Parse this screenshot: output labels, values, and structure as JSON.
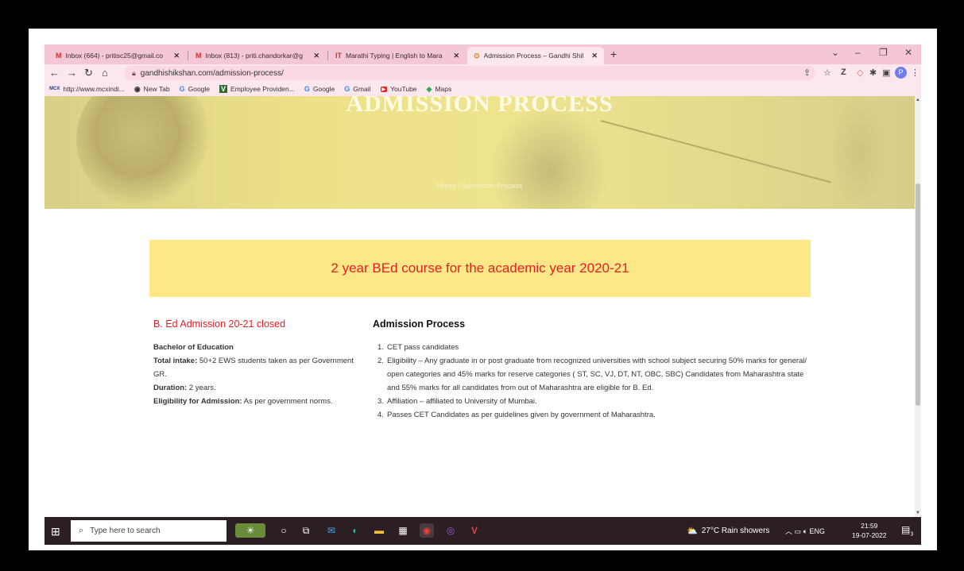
{
  "browser": {
    "tabs": [
      {
        "icon": "gmail-icon",
        "glyph": "M",
        "title": "Inbox (664) - pritisc25@gmail.co",
        "color": "#d93025"
      },
      {
        "icon": "gmail-icon",
        "glyph": "M",
        "title": "Inbox (813) - priti.chandorkar@g",
        "color": "#d93025"
      },
      {
        "icon": "typing-icon",
        "glyph": "IT",
        "title": "Marathi Typing | English to Mara",
        "color": "#d93025"
      },
      {
        "icon": "site-icon",
        "glyph": "⊙",
        "title": "Admission Process – Gandhi Shil",
        "color": "#e8710a"
      }
    ],
    "close_glyph": "✕",
    "new_tab_glyph": "+",
    "url": "gandhishikshan.com/admission-process/",
    "profile_initial": "P",
    "bookmarks": [
      {
        "icon": "mcx-icon",
        "glyph": "MCX",
        "label": "http://www.mcxindi..."
      },
      {
        "icon": "globe-icon",
        "glyph": "◉",
        "label": "New Tab"
      },
      {
        "icon": "google-icon",
        "glyph": "G",
        "label": "Google"
      },
      {
        "icon": "epfo-icon",
        "glyph": "V",
        "label": "Employee Providen..."
      },
      {
        "icon": "google-icon",
        "glyph": "G",
        "label": "Google"
      },
      {
        "icon": "google-icon",
        "glyph": "G",
        "label": "Gmail"
      },
      {
        "icon": "youtube-icon",
        "glyph": "▶",
        "label": "YouTube"
      },
      {
        "icon": "maps-icon",
        "glyph": "◆",
        "label": "Maps"
      }
    ]
  },
  "hero": {
    "title": "ADMISSION PROCESS",
    "breadcrumb": "Home  /  Admission Process"
  },
  "banner": {
    "text": "2 year BEd course for the academic year 2020-21"
  },
  "left": {
    "heading": "B. Ed Admission 20-21 closed",
    "course": "Bachelor of Education",
    "intake_label": "Total intake:",
    "intake_value": " 50+2 EWS students taken as per Government GR.",
    "duration_label": "Duration:",
    "duration_value": " 2 years.",
    "eligibility_label": "Eligibility for Admission:",
    "eligibility_value": " As per government norms."
  },
  "right": {
    "heading": "Admission Process",
    "items": [
      {
        "num": "1.",
        "text": "CET pass candidates"
      },
      {
        "num": "2.",
        "text": "Eligibility – Any graduate in or post graduate from recognized universities with school subject securing 50% marks for general/ open categories and 45% marks for reserve categories ( ST, SC, VJ, DT, NT, OBC, SBC) Candidates from Maharashtra state and 55% marks for all candidates from out of Maharashtra are eligible for B. Ed."
      },
      {
        "num": "3.",
        "text": "Affiliation – affiliated to University of Mumbai."
      },
      {
        "num": "4.",
        "text": "Passes CET Candidates as per guidelines given by government of Maharashtra."
      }
    ]
  },
  "taskbar": {
    "search_placeholder": "Type here to search",
    "weather": "27°C  Rain showers",
    "language": "ENG",
    "time": "21:59",
    "date": "19-07-2022",
    "notifications": "3"
  }
}
